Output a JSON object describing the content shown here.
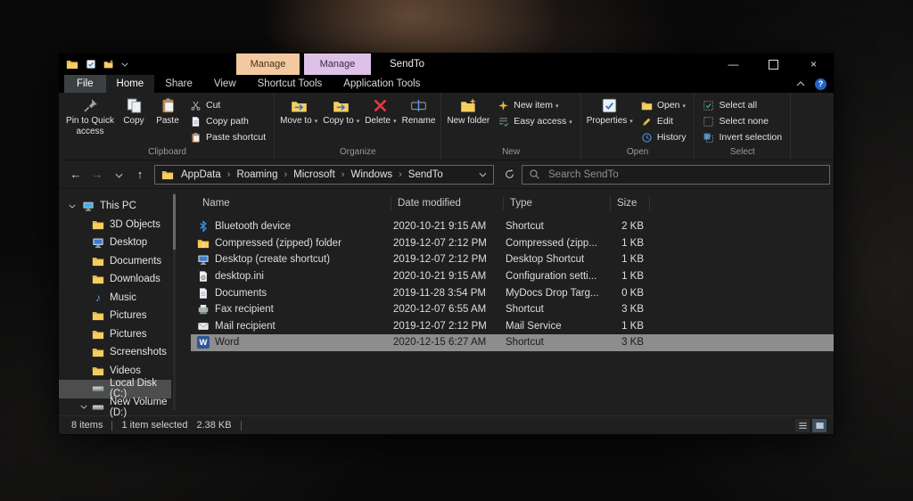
{
  "icons": {
    "back": "←",
    "forward": "→",
    "up": "↑",
    "minimize": "—",
    "close": "×",
    "help": "?",
    "music": "♪",
    "crumb_sep": "›"
  },
  "titlebar": {
    "title": "SendTo",
    "contextual_tabs": [
      {
        "label": "Manage"
      },
      {
        "label": "Manage"
      }
    ]
  },
  "tabs": {
    "file": "File",
    "home": "Home",
    "share": "Share",
    "view": "View",
    "shortcut_tools": "Shortcut Tools",
    "application_tools": "Application Tools"
  },
  "ribbon": {
    "clipboard": {
      "label": "Clipboard",
      "pin": "Pin to Quick access",
      "copy": "Copy",
      "paste": "Paste",
      "cut": "Cut",
      "copy_path": "Copy path",
      "paste_shortcut": "Paste shortcut"
    },
    "organize": {
      "label": "Organize",
      "move_to": "Move to",
      "copy_to": "Copy to",
      "delete": "Delete",
      "rename": "Rename"
    },
    "new": {
      "label": "New",
      "new_folder": "New folder",
      "new_item": "New item",
      "easy_access": "Easy access"
    },
    "open": {
      "label": "Open",
      "properties": "Properties",
      "open": "Open",
      "edit": "Edit",
      "history": "History"
    },
    "select": {
      "label": "Select",
      "select_all": "Select all",
      "select_none": "Select none",
      "invert_selection": "Invert selection"
    }
  },
  "addressbar": {
    "crumbs": [
      "AppData",
      "Roaming",
      "Microsoft",
      "Windows",
      "SendTo"
    ],
    "search_placeholder": "Search SendTo"
  },
  "sidebar": {
    "items": [
      {
        "label": "This PC"
      },
      {
        "label": "3D Objects"
      },
      {
        "label": "Desktop"
      },
      {
        "label": "Documents"
      },
      {
        "label": "Downloads"
      },
      {
        "label": "Music"
      },
      {
        "label": "Pictures"
      },
      {
        "label": "Pictures"
      },
      {
        "label": "Screenshots"
      },
      {
        "label": "Videos"
      },
      {
        "label": "Local Disk (C:)"
      },
      {
        "label": "New Volume (D:)"
      }
    ]
  },
  "filelist": {
    "columns": [
      "Name",
      "Date modified",
      "Type",
      "Size"
    ],
    "word_badge": "W",
    "rows": [
      {
        "name": "Bluetooth device",
        "date": "2020-10-21 9:15 AM",
        "type": "Shortcut",
        "size": "2 KB"
      },
      {
        "name": "Compressed (zipped) folder",
        "date": "2019-12-07 2:12 PM",
        "type": "Compressed (zipp...",
        "size": "1 KB"
      },
      {
        "name": "Desktop (create shortcut)",
        "date": "2019-12-07 2:12 PM",
        "type": "Desktop Shortcut",
        "size": "1 KB"
      },
      {
        "name": "desktop.ini",
        "date": "2020-10-21 9:15 AM",
        "type": "Configuration setti...",
        "size": "1 KB"
      },
      {
        "name": "Documents",
        "date": "2019-11-28 3:54 PM",
        "type": "MyDocs Drop Targ...",
        "size": "0 KB"
      },
      {
        "name": "Fax recipient",
        "date": "2020-12-07 6:55 AM",
        "type": "Shortcut",
        "size": "3 KB"
      },
      {
        "name": "Mail recipient",
        "date": "2019-12-07 2:12 PM",
        "type": "Mail Service",
        "size": "1 KB"
      },
      {
        "name": "Word",
        "date": "2020-12-15 6:27 AM",
        "type": "Shortcut",
        "size": "3 KB"
      }
    ]
  },
  "statusbar": {
    "items_count": "8 items",
    "selection": "1 item selected",
    "selection_size": "2.38 KB"
  }
}
